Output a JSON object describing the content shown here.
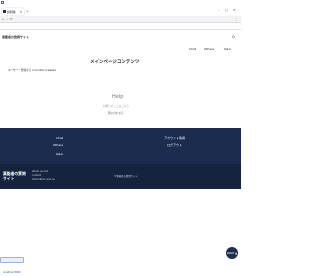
{
  "browser": {
    "tab_label": "質問箱",
    "url": "localhost:3000/questions"
  },
  "bookmarks": [
    {
      "label": "質問一覧"
    },
    {
      "label": "ユーザー登録"
    },
    {
      "label": "質問投稿"
    }
  ],
  "site": {
    "logo": "異能者の質問サイト",
    "search_label": "Q",
    "nav": [
      {
        "label": "Chat"
      },
      {
        "label": "Others"
      },
      {
        "label": "Q&A"
      }
    ]
  },
  "main": {
    "heading": "メインページコンテンツ",
    "user_line": "ユーザー・登録から 2 months 4 weeks",
    "help_title": "Help",
    "help_sub": "お困りのことはこちら",
    "help_link": "問い合わせる"
  },
  "footer": {
    "left_links": [
      "Chat",
      "Others",
      "Q&A"
    ],
    "right_links": [
      "アカウント情報",
      "ログアウト"
    ],
    "brand": "異能者の質問サイト",
    "about_line1": "About us and",
    "about_line2": "contact",
    "about_line3": "Information and us",
    "copyright": "©異能者の質問サイト"
  },
  "status_bar": "localhost:3000",
  "fab_label": "PAGE ▲",
  "colors": {
    "navy": "#1c2c4f",
    "highlight": "#d23a3a"
  }
}
